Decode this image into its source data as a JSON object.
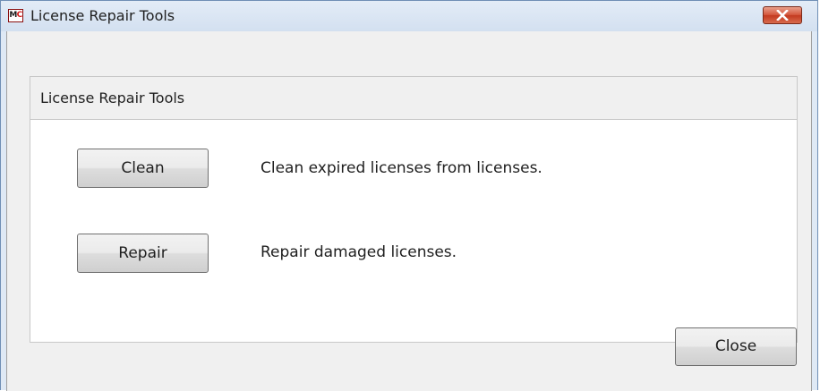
{
  "window": {
    "title": "License Repair Tools",
    "icon_letters": {
      "first": "M",
      "second": "C"
    },
    "close_icon": "close-x-icon"
  },
  "group": {
    "title": "License Repair Tools",
    "actions": [
      {
        "button_label": "Clean",
        "description": "Clean expired licenses from licenses."
      },
      {
        "button_label": "Repair",
        "description": "Repair damaged licenses."
      }
    ]
  },
  "footer": {
    "close_label": "Close"
  },
  "colors": {
    "titlebar": "#dfe9f5",
    "close_button": "#c9452a",
    "client_background": "#f0f0f0",
    "group_background": "#ffffff"
  }
}
